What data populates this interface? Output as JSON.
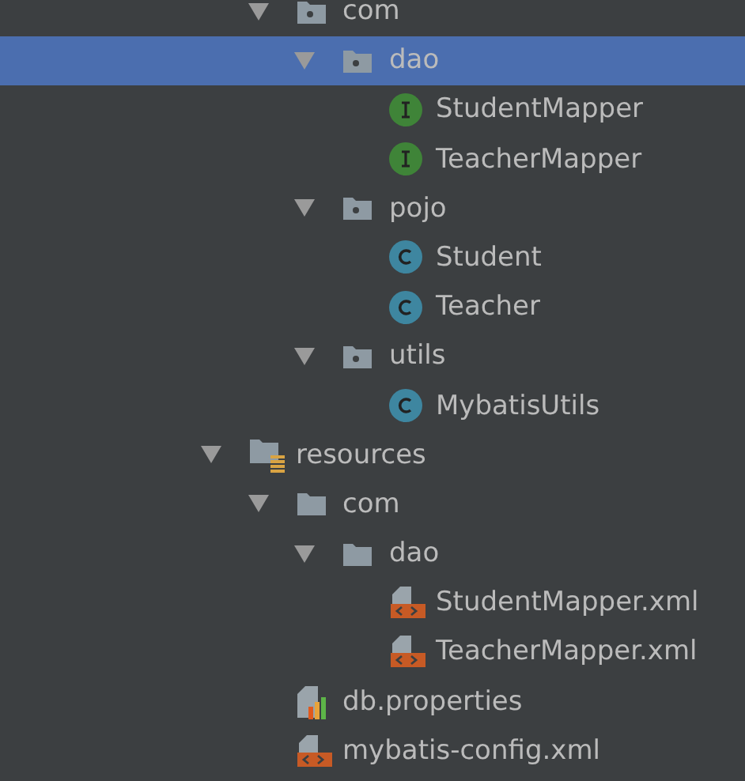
{
  "tree": {
    "continued_children": [
      {
        "label": "com",
        "kind": "package",
        "expanded": true,
        "selected": false,
        "children": [
          {
            "label": "dao",
            "kind": "package",
            "expanded": true,
            "selected": true,
            "children": [
              {
                "label": "StudentMapper",
                "kind": "interface",
                "selected": false
              },
              {
                "label": "TeacherMapper",
                "kind": "interface",
                "selected": false
              }
            ]
          },
          {
            "label": "pojo",
            "kind": "package",
            "expanded": true,
            "selected": false,
            "children": [
              {
                "label": "Student",
                "kind": "class",
                "selected": false
              },
              {
                "label": "Teacher",
                "kind": "class",
                "selected": false
              }
            ]
          },
          {
            "label": "utils",
            "kind": "package",
            "expanded": true,
            "selected": false,
            "children": [
              {
                "label": "MybatisUtils",
                "kind": "class",
                "selected": false
              }
            ]
          }
        ]
      }
    ],
    "items": [
      {
        "label": "resources",
        "kind": "resources_root",
        "expanded": true,
        "selected": false,
        "children": [
          {
            "label": "com",
            "kind": "folder",
            "expanded": true,
            "selected": false,
            "children": [
              {
                "label": "dao",
                "kind": "folder",
                "expanded": true,
                "selected": false,
                "children": [
                  {
                    "label": "StudentMapper.xml",
                    "kind": "xml",
                    "selected": false
                  },
                  {
                    "label": "TeacherMapper.xml",
                    "kind": "xml",
                    "selected": false
                  }
                ]
              }
            ]
          },
          {
            "label": "db.properties",
            "kind": "properties",
            "selected": false
          },
          {
            "label": "mybatis-config.xml",
            "kind": "xml",
            "selected": false
          }
        ]
      }
    ]
  }
}
